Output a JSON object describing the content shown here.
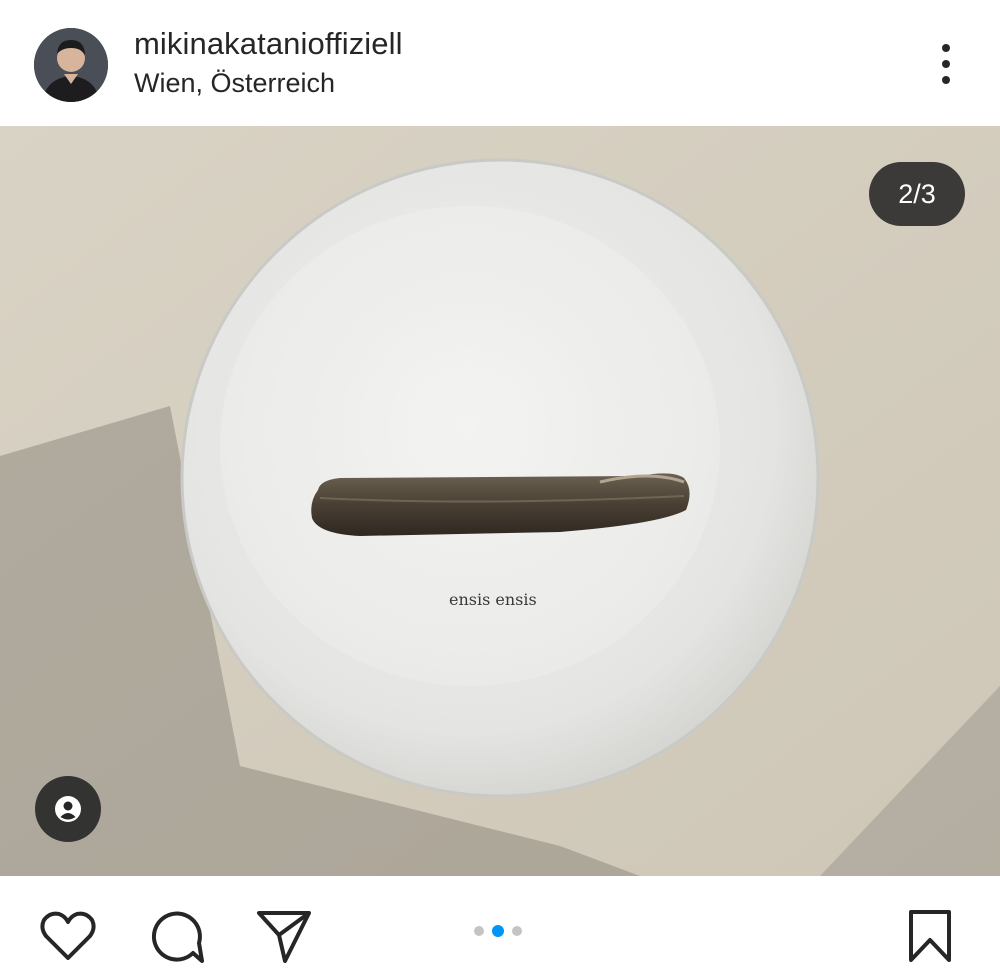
{
  "post": {
    "username": "mikinakatanioffiziell",
    "location": "Wien, Österreich",
    "counter": "2/3",
    "current_slide": 2,
    "total_slides": 3,
    "print_caption": "ensis ensis"
  },
  "icons": {
    "more": "more-vertical-icon",
    "tags": "user-tag-icon",
    "like": "heart-icon",
    "comment": "comment-icon",
    "share": "paper-plane-icon",
    "save": "bookmark-icon"
  },
  "colors": {
    "text": "#262626",
    "pager_active": "#0095f6",
    "pager_inactive": "#c4c4c4"
  }
}
